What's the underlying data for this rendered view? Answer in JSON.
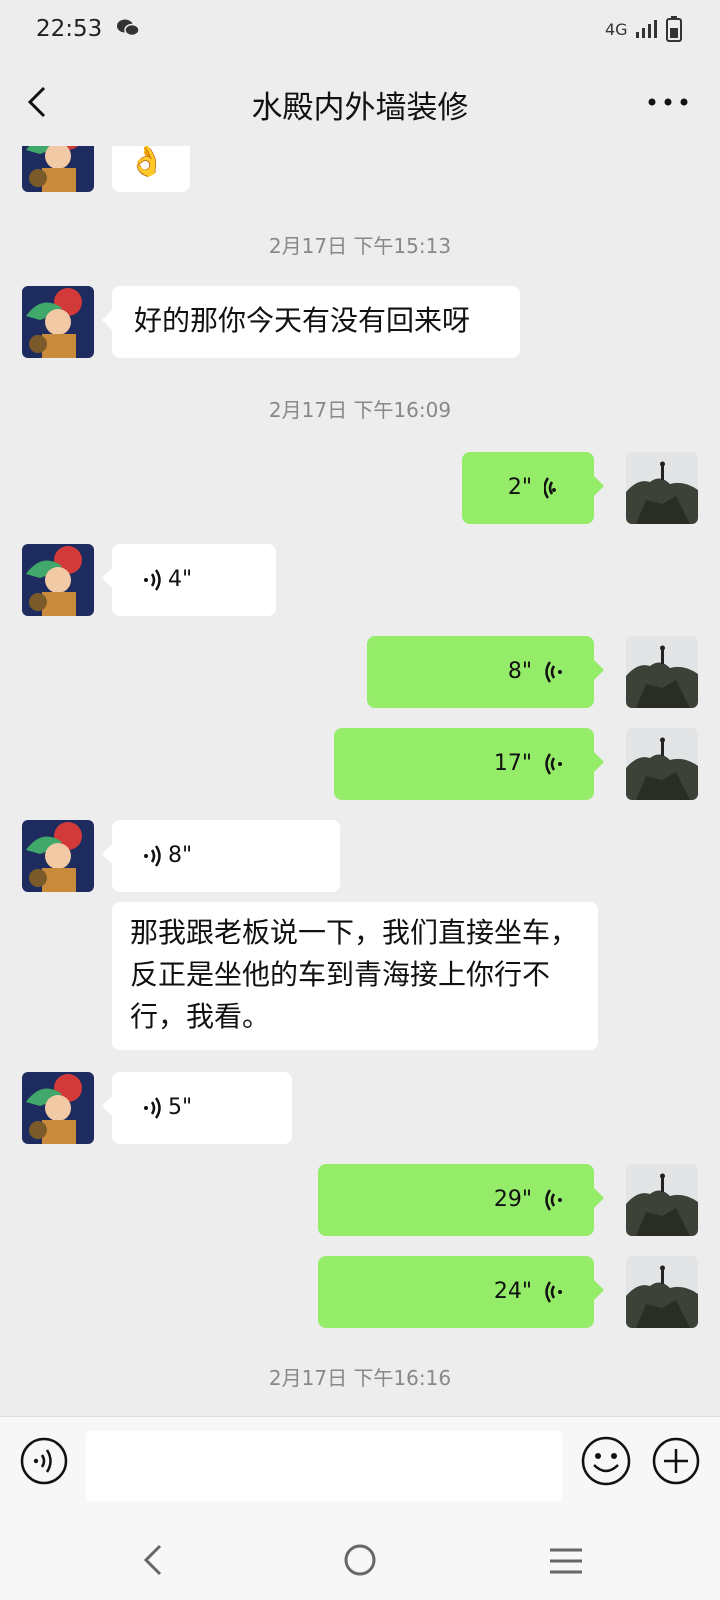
{
  "status_bar": {
    "time": "22:53",
    "network": "4G"
  },
  "header": {
    "title": "水殿内外墙装修"
  },
  "messages": [
    {
      "kind": "emoji",
      "emoji": "👌"
    },
    {
      "kind": "timestamp",
      "text": "2月17日 下午15:13"
    },
    {
      "kind": "text_in",
      "text": "好的那你今天有没有回来呀"
    },
    {
      "kind": "timestamp",
      "text": "2月17日 下午16:09"
    },
    {
      "kind": "voice_out",
      "duration": "2\""
    },
    {
      "kind": "voice_in",
      "duration": "4\""
    },
    {
      "kind": "voice_out",
      "duration": "8\""
    },
    {
      "kind": "voice_out",
      "duration": "17\""
    },
    {
      "kind": "voice_in",
      "duration": "8\""
    },
    {
      "kind": "text_in",
      "text": "那我跟老板说一下，我们直接坐车，反正是坐他的车到青海接上你行不行，我看。"
    },
    {
      "kind": "voice_in",
      "duration": "5\""
    },
    {
      "kind": "voice_out",
      "duration": "29\""
    },
    {
      "kind": "voice_out",
      "duration": "24\""
    },
    {
      "kind": "timestamp",
      "text": "2月17日 下午16:16"
    }
  ],
  "composer": {
    "input_value": "",
    "placeholder": ""
  },
  "colors": {
    "outgoing_bubble": "#95ec69",
    "incoming_bubble": "#ffffff",
    "background": "#ededed"
  }
}
